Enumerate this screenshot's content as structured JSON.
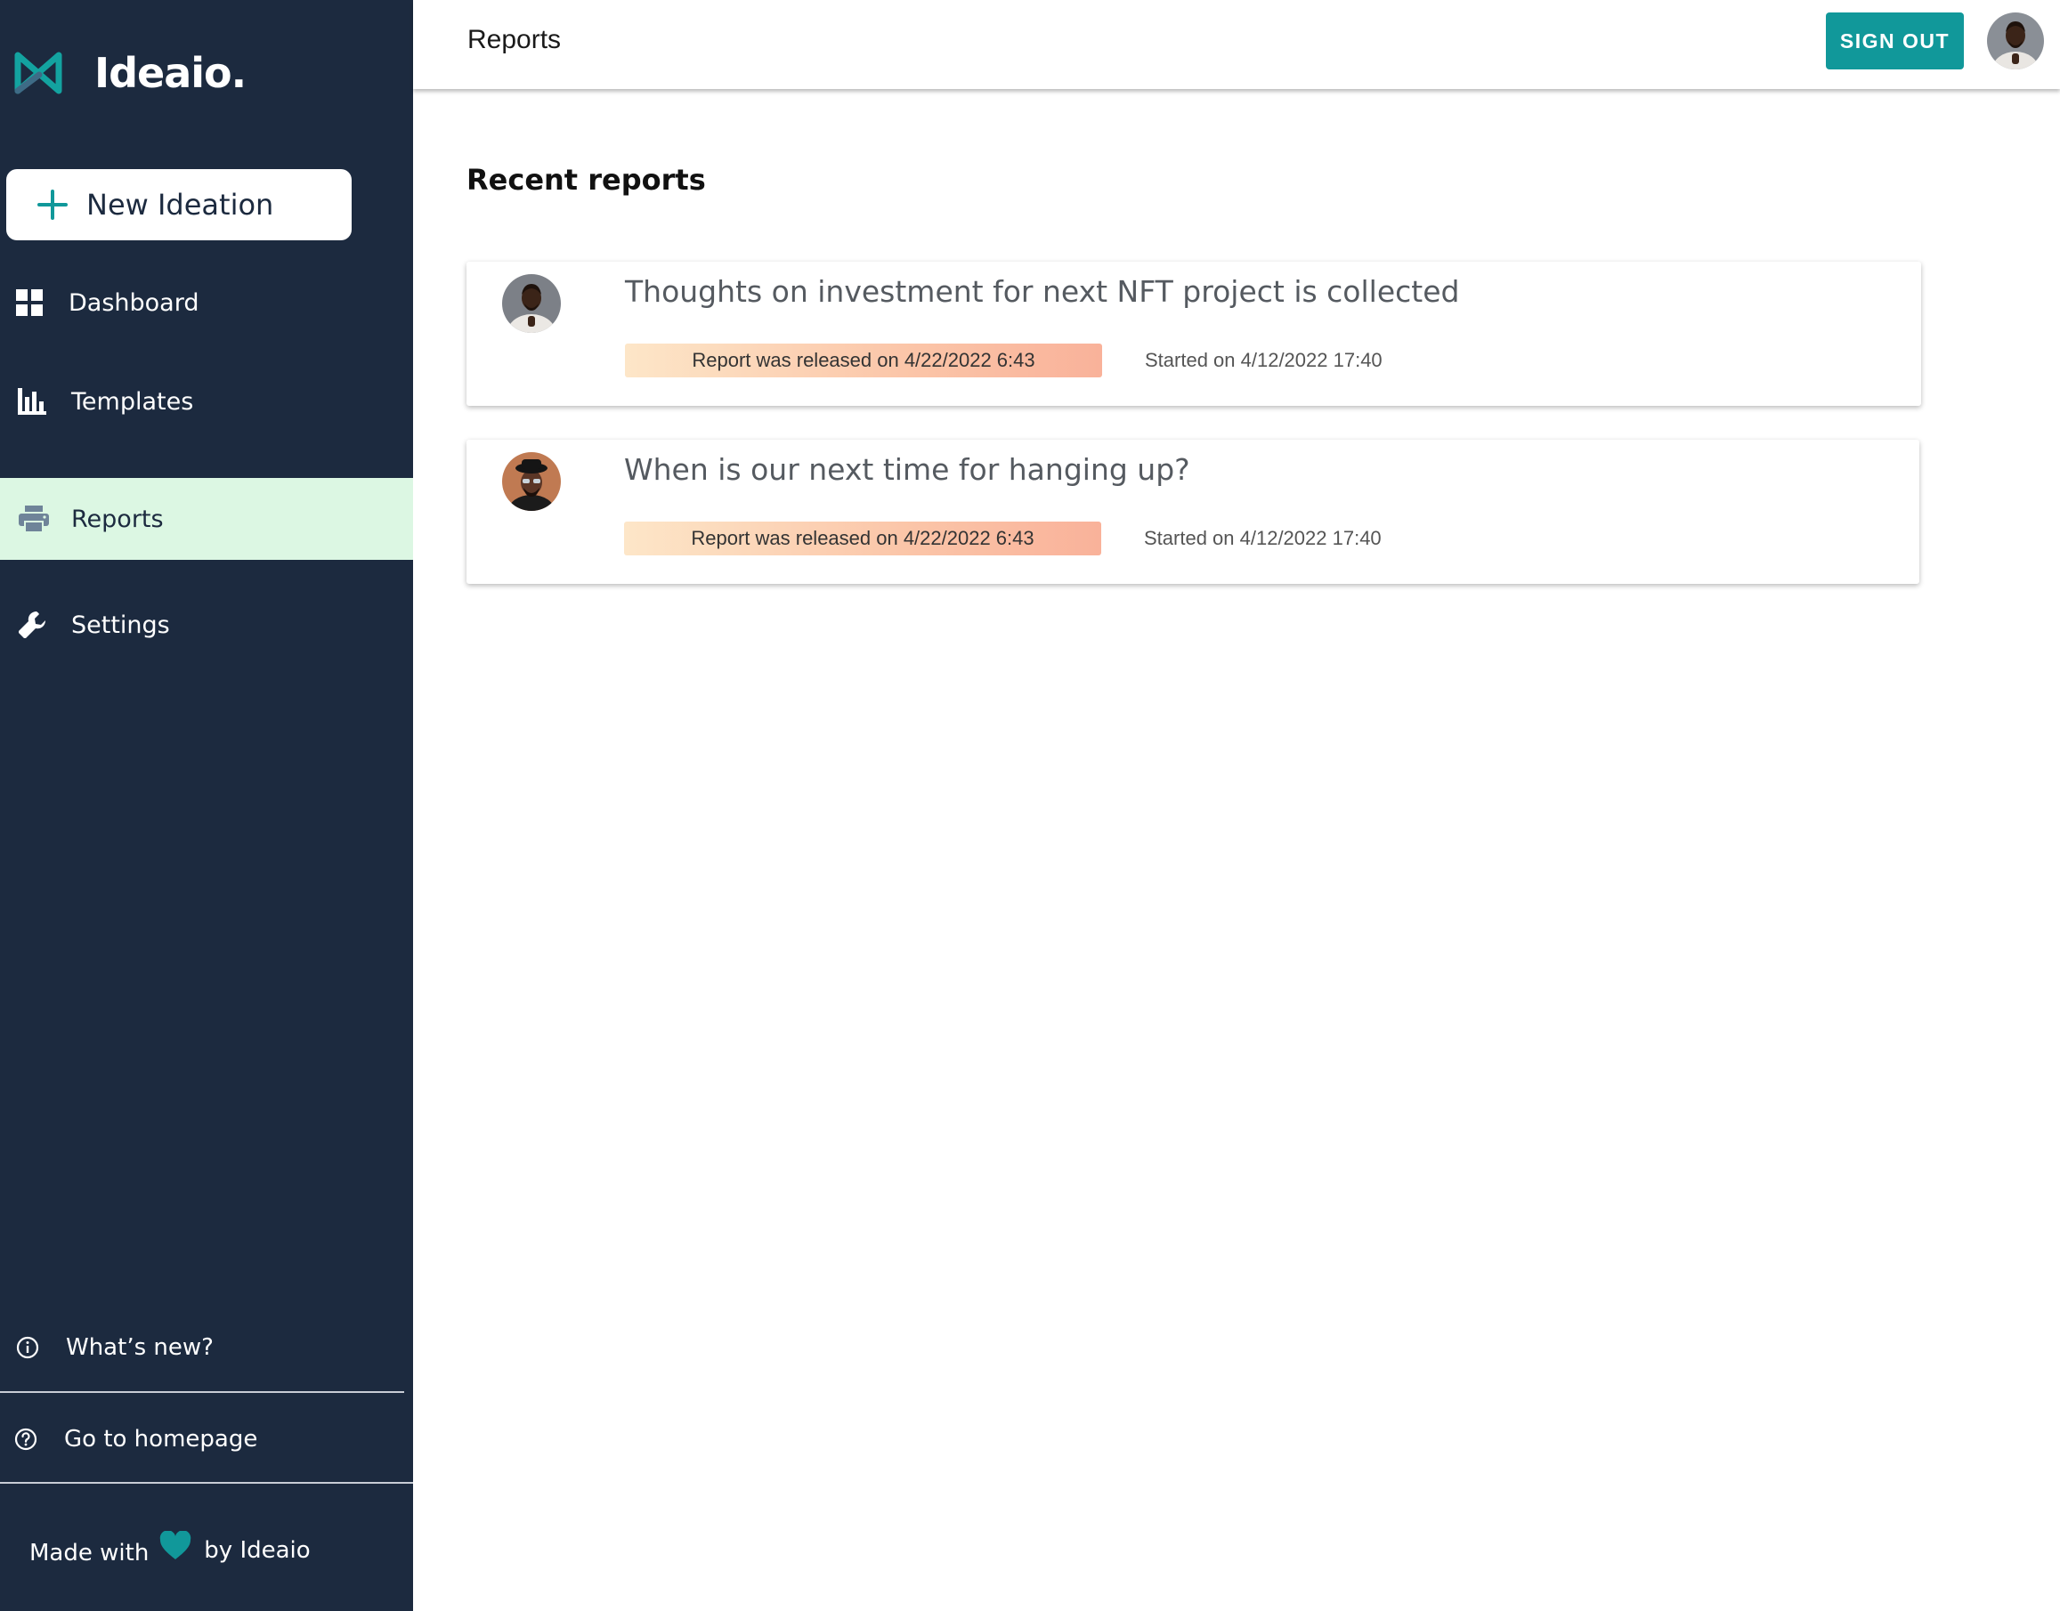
{
  "app": {
    "brand": "Ideaio.",
    "accent_color": "#11989a",
    "sidebar_bg": "#1c2a3f",
    "active_bg": "#dcf7e3"
  },
  "sidebar": {
    "new_button": {
      "label": "New Ideation",
      "icon": "plus-icon"
    },
    "items": [
      {
        "label": "Dashboard",
        "icon": "dashboard-grid-icon",
        "active": false
      },
      {
        "label": "Templates",
        "icon": "bar-chart-icon",
        "active": false
      },
      {
        "label": "Reports",
        "icon": "printer-icon",
        "active": true
      },
      {
        "label": "Settings",
        "icon": "wrench-icon",
        "active": false
      }
    ],
    "bottom_links": [
      {
        "label": "What’s new?",
        "icon": "info-circle-icon"
      },
      {
        "label": "Go to homepage",
        "icon": "help-circle-icon"
      }
    ],
    "footer": {
      "prefix": "Made with",
      "suffix": "by Ideaio",
      "icon": "heart-icon"
    }
  },
  "header": {
    "title": "Reports",
    "sign_out_label": "SIGN OUT",
    "avatar": "user-avatar"
  },
  "main": {
    "section_title": "Recent reports",
    "reports": [
      {
        "title": "Thoughts on investment for next NFT project is collected",
        "released": "Report was released on 4/22/2022 6:43",
        "started": "Started on 4/12/2022 17:40"
      },
      {
        "title": "When is our next time for hanging up?",
        "released": "Report was released on 4/22/2022 6:43",
        "started": "Started on 4/12/2022 17:40"
      }
    ]
  }
}
